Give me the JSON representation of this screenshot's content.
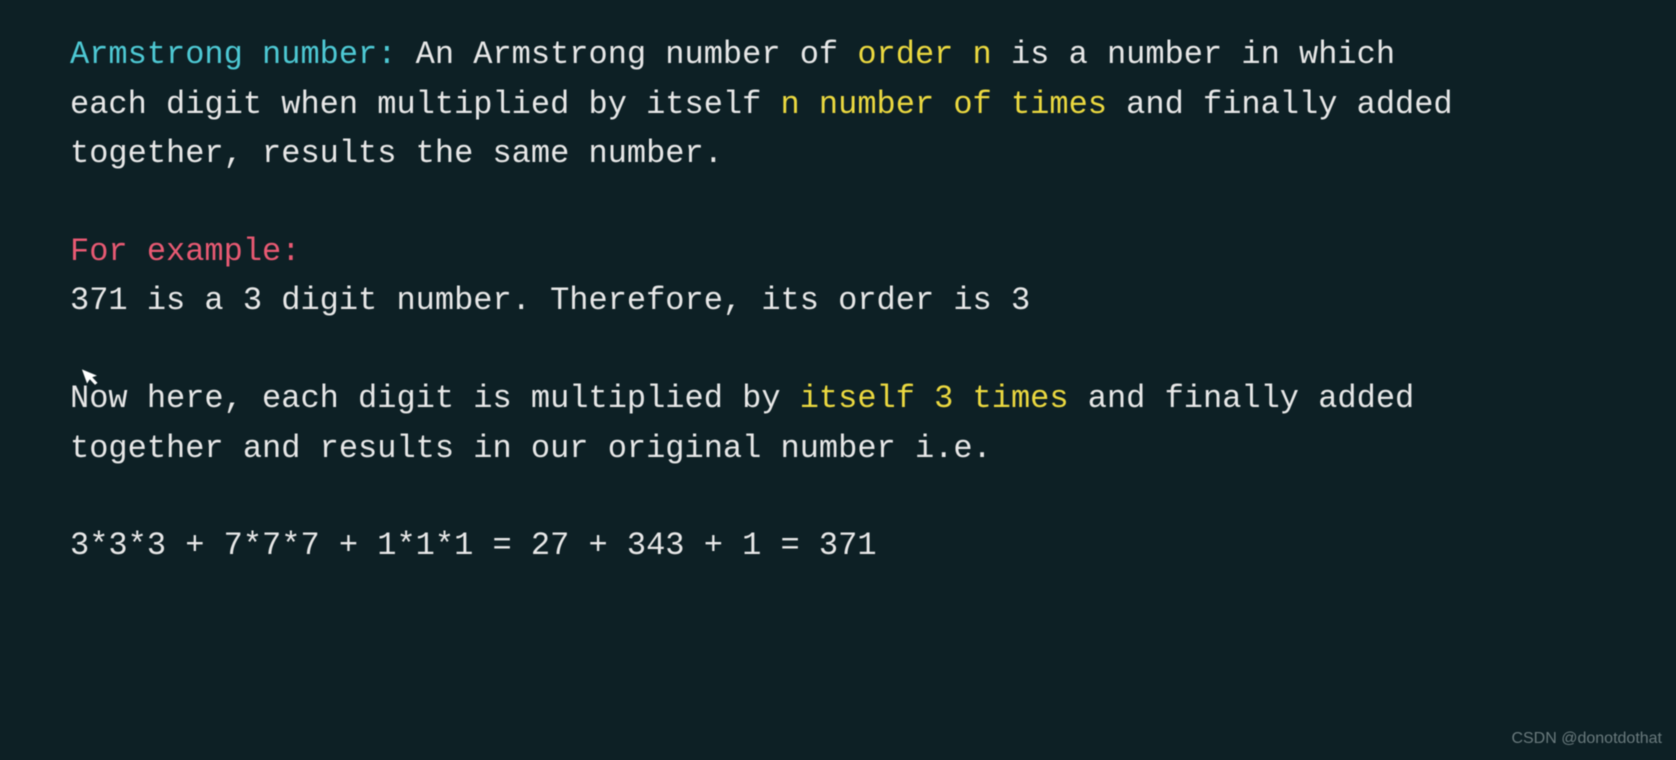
{
  "para1": {
    "title": "Armstrong number:",
    "text1": " An Armstrong number of ",
    "highlight1": "order n",
    "text2": " is a number in which each digit when multiplied by itself ",
    "highlight2": "n number of times",
    "text3": " and finally added together, results the same number."
  },
  "para2": {
    "title": "For example:",
    "text": "371 is a 3 digit number. Therefore, its order is 3"
  },
  "para3": {
    "text1": "Now here, each digit is multiplied by ",
    "highlight1": "itself 3 times",
    "text2": " and finally added together and results in our original number i.e."
  },
  "equation": "3*3*3 + 7*7*7 + 1*1*1 = 27 + 343 + 1 = 371",
  "watermark": "CSDN @donotdothat"
}
